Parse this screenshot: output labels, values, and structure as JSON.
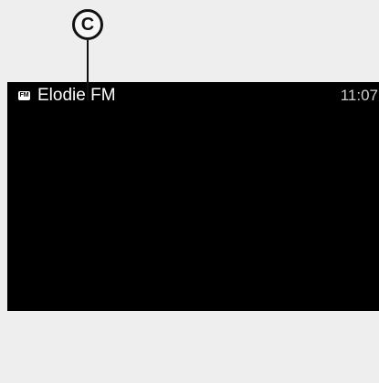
{
  "callout": {
    "label": "C"
  },
  "status_bar": {
    "source_icon": "radio-fm-icon",
    "source_icon_text": "FM",
    "station_name": "Elodie FM",
    "time": "11:07"
  },
  "colors": {
    "screen_background": "#000000",
    "page_background": "#eeeeee",
    "text": "#ffffff"
  }
}
